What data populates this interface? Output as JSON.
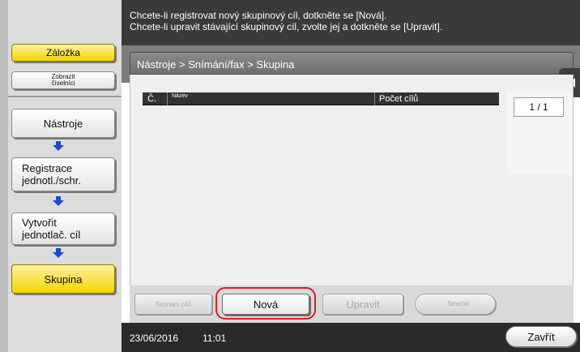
{
  "instructions": {
    "line1": "Chcete-li registrovat nový skupinový cíl, dotkněte se [Nová].",
    "line2": "Chcete-li upravit stávající skupinový cíl, zvolte jej a dotkněte se [Upravit]."
  },
  "sidebar": {
    "bookmark": "Záložka",
    "show_keypad": "Zobrazit číselníci",
    "steps": [
      {
        "label": "Nástroje"
      },
      {
        "label": "Registrace jednotl./schr."
      },
      {
        "label": "Vytvořit jednotlač. cíl"
      },
      {
        "label": "Skupina"
      }
    ]
  },
  "breadcrumb": "Nástroje > Snímání/fax > Skupina",
  "table": {
    "columns": [
      "Č.",
      "Název",
      "Počet cílů"
    ]
  },
  "page_indicator": "1 / 1",
  "buttons": {
    "list": "Seznam cílů",
    "new": "Nová",
    "edit": "Upravit",
    "delete": "Smazat"
  },
  "footer": {
    "date": "23/06/2016",
    "time": "11:01",
    "close": "Zavřít"
  },
  "colors": {
    "accent_yellow": "#f2d400",
    "highlight_red": "#d4202a",
    "arrow_blue": "#1a4bd6"
  }
}
